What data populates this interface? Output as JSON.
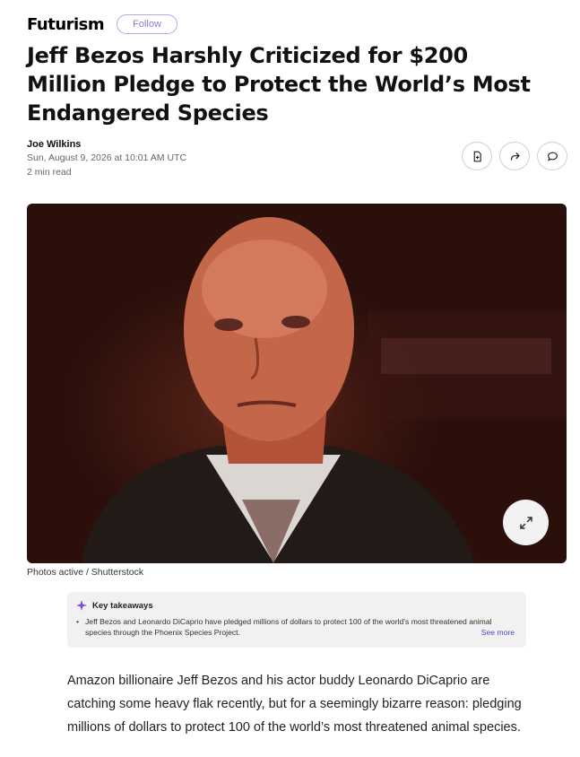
{
  "publisher": {
    "logo_text": "Futurism",
    "follow_label": "Follow"
  },
  "article": {
    "headline": "Jeff Bezos Harshly Criticized for $200 Million Pledge to Protect the World’s Most Endangered Species",
    "author": "Joe Wilkins",
    "date": "Sun, August 9, 2026 at 10:01 AM UTC",
    "read_time": "2 min read",
    "image_caption": "Photos active / Shutterstock",
    "body_paragraph": "Amazon billionaire Jeff Bezos and his actor buddy Leonardo DiCaprio are catching some heavy flak recently, but for a seemingly bizarre reason: pledging millions of dollars to protect 100 of the world’s most threatened animal species."
  },
  "actions": {
    "save_icon": "save-icon",
    "share_icon": "share-icon",
    "comment_icon": "comment-icon"
  },
  "takeaways": {
    "title": "Key takeaways",
    "items": [
      "Jeff Bezos and Leonardo DiCaprio have pledged millions of dollars to protect 100 of the world’s most threatened animal species through the Phoenix Species Project."
    ],
    "see_more_label": "See more"
  },
  "colors": {
    "follow_border": "#b5a8e8",
    "accent_purple": "#7b4de0",
    "link_blue": "#4a4ad0"
  }
}
